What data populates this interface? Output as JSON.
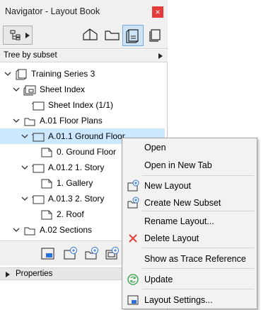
{
  "window": {
    "title": "Navigator - Layout Book",
    "close_label": "×"
  },
  "toolbar": {
    "items": [
      "navigator-dropdown",
      "project-map",
      "view-map",
      "layout-book",
      "publisher-sets"
    ]
  },
  "mode": {
    "selected": "Tree by subset",
    "arrow": "▸"
  },
  "tree": [
    {
      "label": "Training Series 3",
      "level": 0,
      "toggle": "down",
      "icon": "book-icon"
    },
    {
      "label": "Sheet Index",
      "level": 1,
      "toggle": "down",
      "icon": "master-icon"
    },
    {
      "label": "Sheet Index (1/1)",
      "level": 2,
      "toggle": "",
      "icon": "layout-icon"
    },
    {
      "label": "A.01 Floor Plans",
      "level": 1,
      "toggle": "down",
      "icon": "subset-icon"
    },
    {
      "label": "A.01.1 Ground Floor",
      "level": 2,
      "toggle": "down",
      "icon": "layout-icon",
      "selected": true
    },
    {
      "label": "0. Ground Floor",
      "level": 3,
      "toggle": "",
      "icon": "drawing-icon"
    },
    {
      "label": "A.01.2 1. Story",
      "level": 2,
      "toggle": "down",
      "icon": "layout-icon"
    },
    {
      "label": "1. Gallery",
      "level": 3,
      "toggle": "",
      "icon": "drawing-icon"
    },
    {
      "label": "A.01.3 2. Story",
      "level": 2,
      "toggle": "down",
      "icon": "layout-icon"
    },
    {
      "label": "2. Roof",
      "level": 3,
      "toggle": "",
      "icon": "drawing-icon"
    },
    {
      "label": "A.02 Sections",
      "level": 1,
      "toggle": "down",
      "icon": "subset-icon"
    }
  ],
  "bottom_toolbar": [
    "layout-settings-icon",
    "new-layout-icon",
    "new-subset-icon",
    "new-master-icon"
  ],
  "properties": {
    "label": "Properties"
  },
  "context_menu": {
    "items": [
      {
        "label": "Open",
        "icon": ""
      },
      {
        "label": "Open in New Tab",
        "icon": ""
      },
      {
        "label": "New Layout",
        "icon": "new-layout-icon"
      },
      {
        "label": "Create New Subset",
        "icon": "new-subset-icon"
      },
      {
        "label": "Rename Layout...",
        "icon": ""
      },
      {
        "label": "Delete Layout",
        "icon": "delete-icon"
      },
      {
        "label": "Show as Trace Reference",
        "icon": ""
      },
      {
        "label": "Update",
        "icon": "update-icon"
      },
      {
        "label": "Layout Settings...",
        "icon": "layout-settings-icon"
      }
    ]
  },
  "colors": {
    "selection": "#cce8ff",
    "delete": "#e0413a",
    "update": "#2e9e46",
    "close": "#e33a3a"
  }
}
